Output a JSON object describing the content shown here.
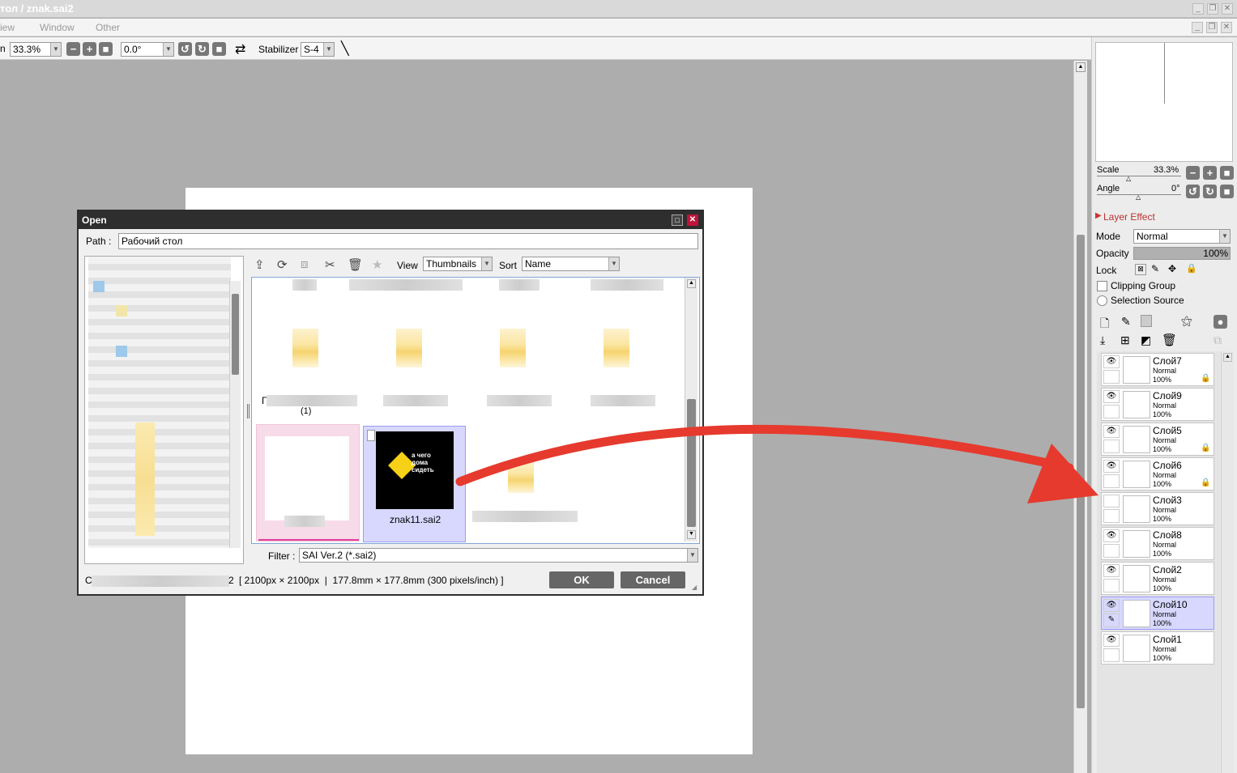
{
  "window": {
    "title": "тол / znak.sai2",
    "min": "_",
    "restore": "❐",
    "close": "✕"
  },
  "menu": {
    "items": [
      "iew",
      "Window",
      "Other"
    ]
  },
  "toolbar": {
    "zoom_prefix": "n",
    "zoom": "33.3%",
    "angle": "0.0°",
    "stabilizer_label": "Stabilizer",
    "stabilizer_value": "S-4"
  },
  "navigator": {
    "scale_label": "Scale",
    "scale_value": "33.3%",
    "angle_label": "Angle",
    "angle_value": "0°"
  },
  "layer_panel": {
    "layer_effect": "Layer Effect",
    "mode_label": "Mode",
    "mode_value": "Normal",
    "opacity_label": "Opacity",
    "opacity_value": "100%",
    "opacity_fraction": 1.0,
    "lock_label": "Lock",
    "clipping_group": "Clipping Group",
    "selection_source": "Selection Source",
    "layers": [
      {
        "name": "Слой7",
        "mode": "Normal",
        "opacity": "100%",
        "visible": true,
        "locked": true,
        "selected": false
      },
      {
        "name": "Слой9",
        "mode": "Normal",
        "opacity": "100%",
        "visible": true,
        "locked": false,
        "selected": false
      },
      {
        "name": "Слой5",
        "mode": "Normal",
        "opacity": "100%",
        "visible": true,
        "locked": true,
        "selected": false
      },
      {
        "name": "Слой6",
        "mode": "Normal",
        "opacity": "100%",
        "visible": true,
        "locked": true,
        "selected": false
      },
      {
        "name": "Слой3",
        "mode": "Normal",
        "opacity": "100%",
        "visible": false,
        "locked": false,
        "selected": false
      },
      {
        "name": "Слой8",
        "mode": "Normal",
        "opacity": "100%",
        "visible": true,
        "locked": false,
        "selected": false
      },
      {
        "name": "Слой2",
        "mode": "Normal",
        "opacity": "100%",
        "visible": true,
        "locked": false,
        "selected": false
      },
      {
        "name": "Слой10",
        "mode": "Normal",
        "opacity": "100%",
        "visible": true,
        "locked": false,
        "selected": true
      },
      {
        "name": "Слой1",
        "mode": "Normal",
        "opacity": "100%",
        "visible": true,
        "locked": false,
        "selected": false
      }
    ]
  },
  "dialog": {
    "title": "Open",
    "path_label": "Path :",
    "path_value": "Рабочий стол",
    "view_label": "View",
    "view_value": "Thumbnails",
    "sort_label": "Sort",
    "sort_value": "Name",
    "file_partial_1": "Г",
    "file_partial_2": "(1)",
    "selected_file": "znak11.sai2",
    "thumb_text": "а чего\nдома\nсидеть",
    "filter_label": "Filter :",
    "filter_value": "SAI Ver.2 (*.sai2)",
    "status_prefix": "С",
    "status_suffix": "2",
    "status_info": "[ 2100px × 2100px  |  177.8mm × 177.8mm (300 pixels/inch) ]",
    "ok": "OK",
    "cancel": "Cancel"
  },
  "colors": {
    "arrow": "#e63a2e",
    "selection": "#d8d8ff",
    "dialog_title": "#2e2e2e"
  }
}
